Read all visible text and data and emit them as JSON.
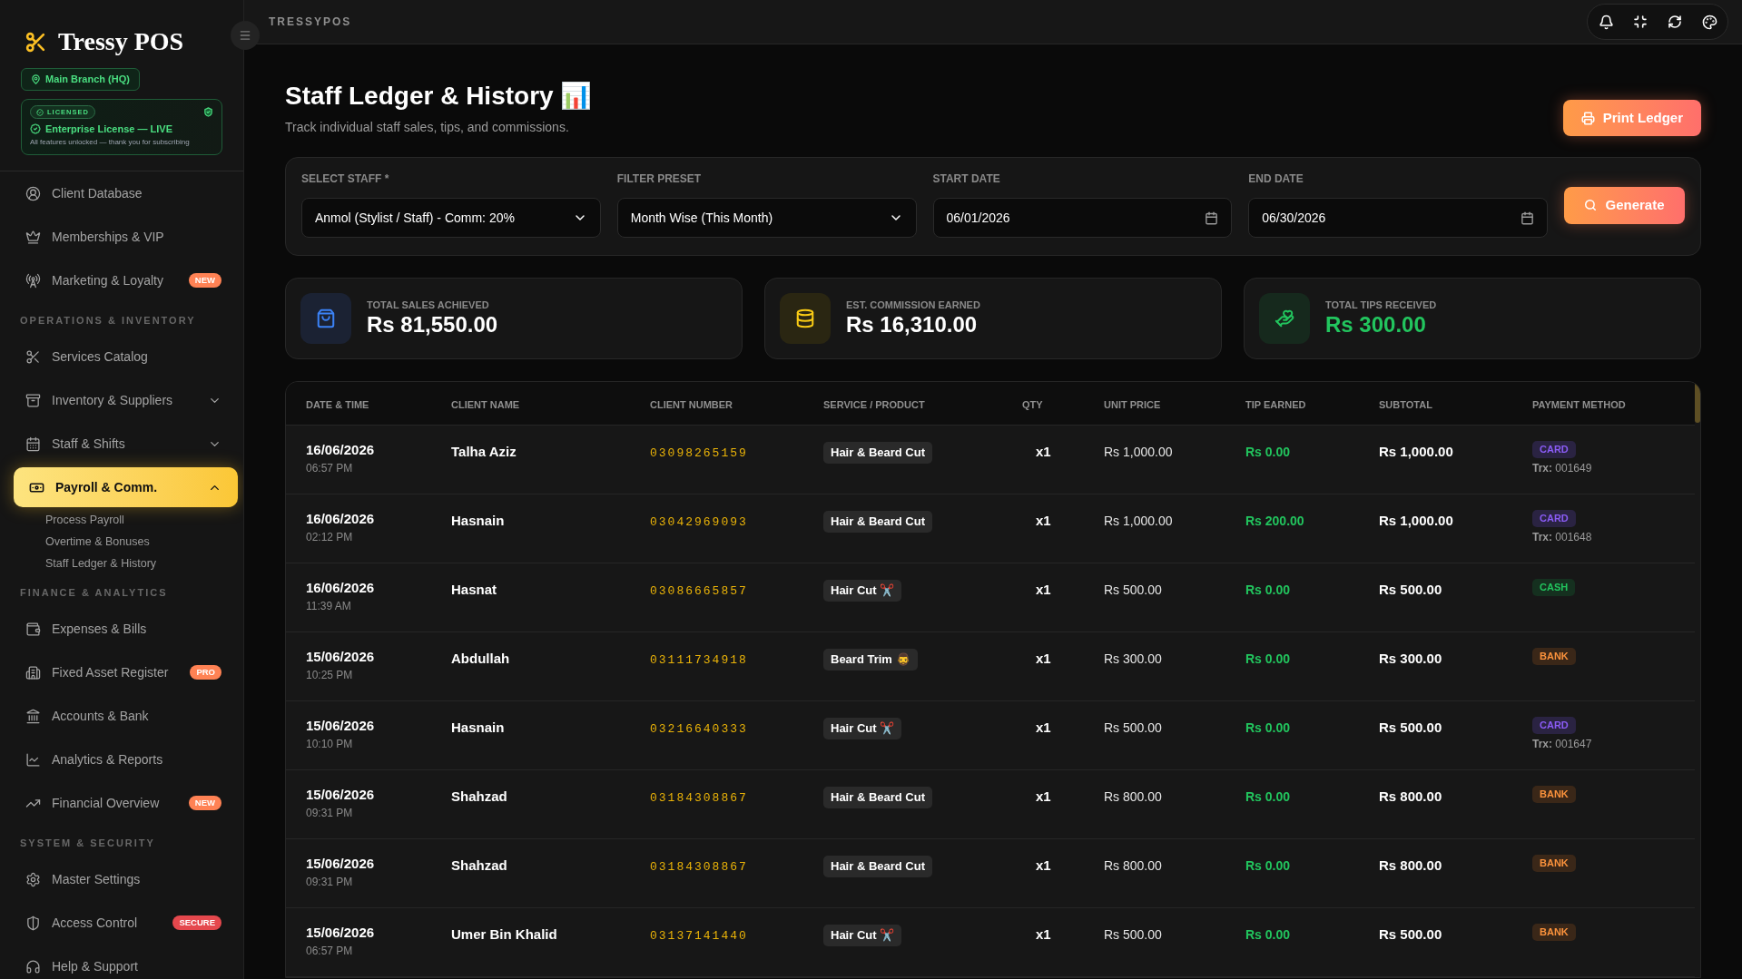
{
  "sidebar": {
    "brand": "Tressy POS",
    "branch": "Main Branch (HQ)",
    "license": {
      "badge": "LICENSED",
      "title": "Enterprise License — LIVE",
      "note": "All features unlocked — thank you for subscribing"
    },
    "sections": [
      {
        "items": [
          {
            "label": "Client Database",
            "selected": false
          },
          {
            "label": "Memberships & VIP",
            "selected": false
          },
          {
            "label": "Marketing & Loyalty",
            "selected": false,
            "badge": {
              "text": "NEW",
              "color": "#ff8254"
            }
          }
        ]
      },
      {
        "heading": "OPERATIONS & INVENTORY",
        "items": [
          {
            "label": "Services Catalog",
            "selected": false
          },
          {
            "label": "Inventory & Suppliers",
            "selected": false,
            "expanded": false
          },
          {
            "label": "Staff & Shifts",
            "selected": false,
            "expanded": false
          },
          {
            "label": "Payroll & Comm.",
            "selected": true,
            "expanded": true,
            "children": [
              {
                "label": "Process Payroll",
                "selected": false
              },
              {
                "label": "Overtime & Bonuses",
                "selected": false
              },
              {
                "label": "Staff Ledger & History",
                "selected": false
              }
            ]
          }
        ]
      },
      {
        "heading": "FINANCE & ANALYTICS",
        "items": [
          {
            "label": "Expenses & Bills",
            "selected": false
          },
          {
            "label": "Fixed Asset Register",
            "selected": false,
            "badge": {
              "text": "PRO",
              "color": "#ff8254"
            }
          },
          {
            "label": "Accounts & Bank",
            "selected": false
          },
          {
            "label": "Analytics & Reports",
            "selected": false
          },
          {
            "label": "Financial Overview",
            "selected": false,
            "badge": {
              "text": "NEW",
              "color": "#ff8254"
            }
          }
        ]
      },
      {
        "heading": "SYSTEM & SECURITY",
        "items": [
          {
            "label": "Master Settings",
            "selected": false
          },
          {
            "label": "Access Control",
            "selected": false,
            "badge": {
              "text": "SECURE",
              "color": "#e5484d"
            }
          },
          {
            "label": "Help & Support",
            "selected": false
          }
        ]
      }
    ]
  },
  "header": {
    "app_name": "TRESSYPOS"
  },
  "page": {
    "title": "Staff Ledger & History 📊",
    "subtitle": "Track individual staff sales, tips, and commissions.",
    "print_button": "Print Ledger"
  },
  "filters": {
    "fields": [
      {
        "label": "SELECT STAFF *",
        "kind": "select",
        "value": "Anmol (Stylist / Staff) - Comm: 20%"
      },
      {
        "label": "FILTER PRESET",
        "kind": "select",
        "value": "Month Wise (This Month)"
      },
      {
        "label": "START DATE",
        "kind": "date",
        "value": "06/01/2026"
      },
      {
        "label": "END DATE",
        "kind": "date",
        "value": "06/30/2026"
      }
    ],
    "button": "Generate"
  },
  "stats": [
    {
      "kind": "sales",
      "label": "TOTAL SALES ACHIEVED",
      "value": "Rs 81,550.00"
    },
    {
      "kind": "commission",
      "label": "EST. COMMISSION EARNED",
      "value": "Rs 16,310.00"
    },
    {
      "kind": "tips",
      "label": "TOTAL TIPS RECEIVED",
      "value": "Rs 300.00"
    }
  ],
  "table": {
    "columns": [
      "DATE & TIME",
      "CLIENT NAME",
      "CLIENT NUMBER",
      "SERVICE / PRODUCT",
      "QTY",
      "UNIT PRICE",
      "TIP EARNED",
      "SUBTOTAL",
      "PAYMENT METHOD"
    ],
    "rows": [
      {
        "date": "16/06/2026",
        "time": "06:57 PM",
        "client": "Talha Aziz",
        "number": "03098265159",
        "service": "Hair & Beard Cut",
        "qty": "x1",
        "unit_price": "Rs 1,000.00",
        "tip": "Rs 0.00",
        "subtotal": "Rs 1,000.00",
        "payment": {
          "method": "CARD",
          "kind": "card",
          "reference": "**Trx:** 001649"
        }
      },
      {
        "date": "16/06/2026",
        "time": "02:12 PM",
        "client": "Hasnain",
        "number": "03042969093",
        "service": "Hair & Beard Cut",
        "qty": "x1",
        "unit_price": "Rs 1,000.00",
        "tip": "Rs 200.00",
        "subtotal": "Rs 1,000.00",
        "payment": {
          "method": "CARD",
          "kind": "card",
          "reference": "**Trx:** 001648"
        }
      },
      {
        "date": "16/06/2026",
        "time": "11:39 AM",
        "client": "Hasnat",
        "number": "03086665857",
        "service": "Hair Cut ✂️",
        "qty": "x1",
        "unit_price": "Rs 500.00",
        "tip": "Rs 0.00",
        "subtotal": "Rs 500.00",
        "payment": {
          "method": "CASH",
          "kind": "cash"
        }
      },
      {
        "date": "15/06/2026",
        "time": "10:25 PM",
        "client": "Abdullah",
        "number": "03111734918",
        "service": "Beard Trim 🧔‍♂️",
        "qty": "x1",
        "unit_price": "Rs 300.00",
        "tip": "Rs 0.00",
        "subtotal": "Rs 300.00",
        "payment": {
          "method": "BANK",
          "kind": "bank"
        }
      },
      {
        "date": "15/06/2026",
        "time": "10:10 PM",
        "client": "Hasnain",
        "number": "03216640333",
        "service": "Hair Cut ✂️",
        "qty": "x1",
        "unit_price": "Rs 500.00",
        "tip": "Rs 0.00",
        "subtotal": "Rs 500.00",
        "payment": {
          "method": "CARD",
          "kind": "card",
          "reference": "**Trx:** 001647"
        }
      },
      {
        "date": "15/06/2026",
        "time": "09:31 PM",
        "client": "Shahzad",
        "number": "03184308867",
        "service": "Hair & Beard Cut",
        "qty": "x1",
        "unit_price": "Rs 800.00",
        "tip": "Rs 0.00",
        "subtotal": "Rs 800.00",
        "payment": {
          "method": "BANK",
          "kind": "bank"
        }
      },
      {
        "date": "15/06/2026",
        "time": "09:31 PM",
        "client": "Shahzad",
        "number": "03184308867",
        "service": "Hair & Beard Cut",
        "qty": "x1",
        "unit_price": "Rs 800.00",
        "tip": "Rs 0.00",
        "subtotal": "Rs 800.00",
        "payment": {
          "method": "BANK",
          "kind": "bank"
        }
      },
      {
        "date": "15/06/2026",
        "time": "06:57 PM",
        "client": "Umer Bin Khalid",
        "number": "03137141440",
        "service": "Hair Cut ✂️",
        "qty": "x1",
        "unit_price": "Rs 500.00",
        "tip": "Rs 0.00",
        "subtotal": "Rs 500.00",
        "payment": {
          "method": "BANK",
          "kind": "bank"
        }
      }
    ]
  }
}
